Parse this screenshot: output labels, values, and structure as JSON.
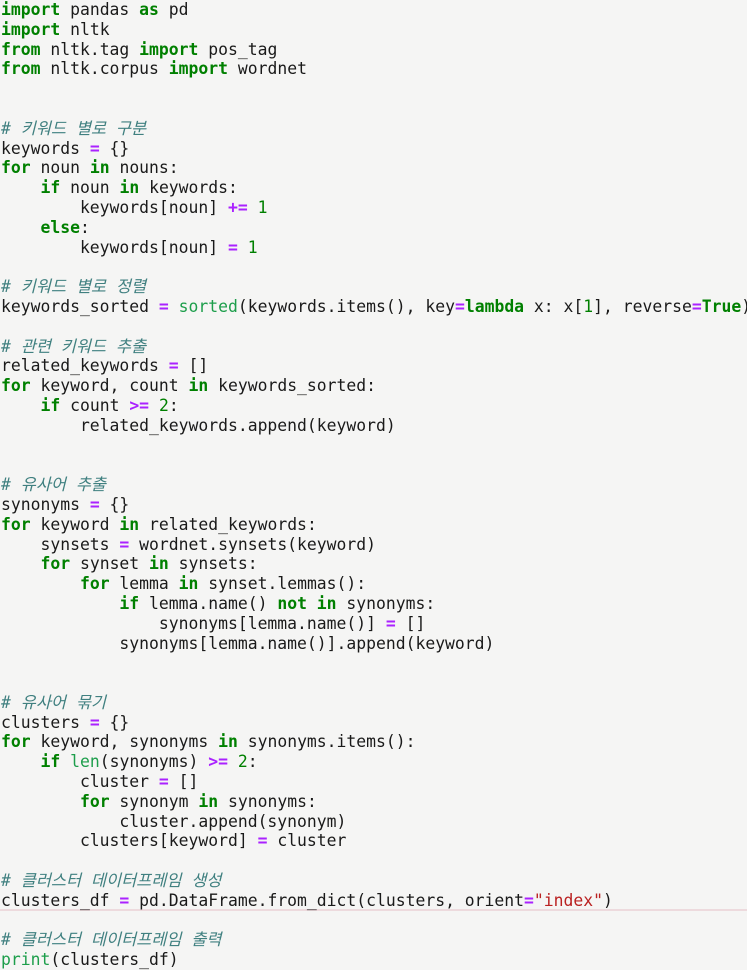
{
  "document": {
    "type": "python-source-code",
    "language": "Python",
    "background_color": "#f5f5f4",
    "bottom_rule_color": "#eddadd",
    "syntax_colors": {
      "keyword": "#008000",
      "builtin": "#1d9e4b",
      "comment": "#408080",
      "operator": "#aa22ff",
      "number": "#008000",
      "string": "#ba2121",
      "plain_text": "#1a1a1a"
    }
  },
  "code": {
    "lines": [
      {
        "id": 1,
        "tokens": [
          {
            "t": "k",
            "v": "import"
          },
          {
            "t": "n",
            "v": " pandas "
          },
          {
            "t": "k",
            "v": "as"
          },
          {
            "t": "n",
            "v": " pd"
          }
        ]
      },
      {
        "id": 2,
        "tokens": [
          {
            "t": "k",
            "v": "import"
          },
          {
            "t": "n",
            "v": " nltk"
          }
        ]
      },
      {
        "id": 3,
        "tokens": [
          {
            "t": "k",
            "v": "from"
          },
          {
            "t": "n",
            "v": " nltk.tag "
          },
          {
            "t": "k",
            "v": "import"
          },
          {
            "t": "n",
            "v": " pos_tag"
          }
        ]
      },
      {
        "id": 4,
        "tokens": [
          {
            "t": "k",
            "v": "from"
          },
          {
            "t": "n",
            "v": " nltk.corpus "
          },
          {
            "t": "k",
            "v": "import"
          },
          {
            "t": "n",
            "v": " wordnet"
          }
        ]
      },
      {
        "id": 5,
        "tokens": []
      },
      {
        "id": 6,
        "tokens": []
      },
      {
        "id": 7,
        "tokens": [
          {
            "t": "c",
            "v": "# 키워드 별로 구분"
          }
        ]
      },
      {
        "id": 8,
        "tokens": [
          {
            "t": "n",
            "v": "keywords "
          },
          {
            "t": "o",
            "v": "="
          },
          {
            "t": "p",
            "v": " {}"
          }
        ]
      },
      {
        "id": 9,
        "tokens": [
          {
            "t": "k",
            "v": "for"
          },
          {
            "t": "n",
            "v": " noun "
          },
          {
            "t": "k",
            "v": "in"
          },
          {
            "t": "n",
            "v": " nouns"
          },
          {
            "t": "p",
            "v": ":"
          }
        ]
      },
      {
        "id": 10,
        "tokens": [
          {
            "t": "n",
            "v": "    "
          },
          {
            "t": "k",
            "v": "if"
          },
          {
            "t": "n",
            "v": " noun "
          },
          {
            "t": "k",
            "v": "in"
          },
          {
            "t": "n",
            "v": " keywords"
          },
          {
            "t": "p",
            "v": ":"
          }
        ]
      },
      {
        "id": 11,
        "tokens": [
          {
            "t": "n",
            "v": "        keywords[noun] "
          },
          {
            "t": "o",
            "v": "+="
          },
          {
            "t": "n",
            "v": " "
          },
          {
            "t": "m",
            "v": "1"
          }
        ]
      },
      {
        "id": 12,
        "tokens": [
          {
            "t": "n",
            "v": "    "
          },
          {
            "t": "k",
            "v": "else"
          },
          {
            "t": "p",
            "v": ":"
          }
        ]
      },
      {
        "id": 13,
        "tokens": [
          {
            "t": "n",
            "v": "        keywords[noun] "
          },
          {
            "t": "o",
            "v": "="
          },
          {
            "t": "n",
            "v": " "
          },
          {
            "t": "m",
            "v": "1"
          }
        ]
      },
      {
        "id": 14,
        "tokens": []
      },
      {
        "id": 15,
        "tokens": [
          {
            "t": "c",
            "v": "# 키워드 별로 정렬"
          }
        ]
      },
      {
        "id": 16,
        "tokens": [
          {
            "t": "n",
            "v": "keywords_sorted "
          },
          {
            "t": "o",
            "v": "="
          },
          {
            "t": "n",
            "v": " "
          },
          {
            "t": "nb",
            "v": "sorted"
          },
          {
            "t": "p",
            "v": "("
          },
          {
            "t": "n",
            "v": "keywords.items(), key"
          },
          {
            "t": "o",
            "v": "="
          },
          {
            "t": "k",
            "v": "lambda"
          },
          {
            "t": "n",
            "v": " x: x["
          },
          {
            "t": "m",
            "v": "1"
          },
          {
            "t": "n",
            "v": "], reverse"
          },
          {
            "t": "o",
            "v": "="
          },
          {
            "t": "kc",
            "v": "True"
          },
          {
            "t": "p",
            "v": ")"
          }
        ]
      },
      {
        "id": 17,
        "tokens": []
      },
      {
        "id": 18,
        "tokens": [
          {
            "t": "c",
            "v": "# 관련 키워드 추출"
          }
        ]
      },
      {
        "id": 19,
        "tokens": [
          {
            "t": "n",
            "v": "related_keywords "
          },
          {
            "t": "o",
            "v": "="
          },
          {
            "t": "p",
            "v": " []"
          }
        ]
      },
      {
        "id": 20,
        "tokens": [
          {
            "t": "k",
            "v": "for"
          },
          {
            "t": "n",
            "v": " keyword, count "
          },
          {
            "t": "k",
            "v": "in"
          },
          {
            "t": "n",
            "v": " keywords_sorted"
          },
          {
            "t": "p",
            "v": ":"
          }
        ]
      },
      {
        "id": 21,
        "tokens": [
          {
            "t": "n",
            "v": "    "
          },
          {
            "t": "k",
            "v": "if"
          },
          {
            "t": "n",
            "v": " count "
          },
          {
            "t": "o",
            "v": ">="
          },
          {
            "t": "n",
            "v": " "
          },
          {
            "t": "m",
            "v": "2"
          },
          {
            "t": "p",
            "v": ":"
          }
        ]
      },
      {
        "id": 22,
        "tokens": [
          {
            "t": "n",
            "v": "        related_keywords.append(keyword)"
          }
        ]
      },
      {
        "id": 23,
        "tokens": []
      },
      {
        "id": 24,
        "tokens": []
      },
      {
        "id": 25,
        "tokens": [
          {
            "t": "c",
            "v": "# 유사어 추출"
          }
        ]
      },
      {
        "id": 26,
        "tokens": [
          {
            "t": "n",
            "v": "synonyms "
          },
          {
            "t": "o",
            "v": "="
          },
          {
            "t": "p",
            "v": " {}"
          }
        ]
      },
      {
        "id": 27,
        "tokens": [
          {
            "t": "k",
            "v": "for"
          },
          {
            "t": "n",
            "v": " keyword "
          },
          {
            "t": "k",
            "v": "in"
          },
          {
            "t": "n",
            "v": " related_keywords"
          },
          {
            "t": "p",
            "v": ":"
          }
        ]
      },
      {
        "id": 28,
        "tokens": [
          {
            "t": "n",
            "v": "    synsets "
          },
          {
            "t": "o",
            "v": "="
          },
          {
            "t": "n",
            "v": " wordnet.synsets(keyword)"
          }
        ]
      },
      {
        "id": 29,
        "tokens": [
          {
            "t": "n",
            "v": "    "
          },
          {
            "t": "k",
            "v": "for"
          },
          {
            "t": "n",
            "v": " synset "
          },
          {
            "t": "k",
            "v": "in"
          },
          {
            "t": "n",
            "v": " synsets"
          },
          {
            "t": "p",
            "v": ":"
          }
        ]
      },
      {
        "id": 30,
        "tokens": [
          {
            "t": "n",
            "v": "        "
          },
          {
            "t": "k",
            "v": "for"
          },
          {
            "t": "n",
            "v": " lemma "
          },
          {
            "t": "k",
            "v": "in"
          },
          {
            "t": "n",
            "v": " synset.lemmas()"
          },
          {
            "t": "p",
            "v": ":"
          }
        ]
      },
      {
        "id": 31,
        "tokens": [
          {
            "t": "n",
            "v": "            "
          },
          {
            "t": "k",
            "v": "if"
          },
          {
            "t": "n",
            "v": " lemma.name() "
          },
          {
            "t": "k",
            "v": "not in"
          },
          {
            "t": "n",
            "v": " synonyms"
          },
          {
            "t": "p",
            "v": ":"
          }
        ]
      },
      {
        "id": 32,
        "tokens": [
          {
            "t": "n",
            "v": "                synonyms[lemma.name()] "
          },
          {
            "t": "o",
            "v": "="
          },
          {
            "t": "p",
            "v": " []"
          }
        ]
      },
      {
        "id": 33,
        "tokens": [
          {
            "t": "n",
            "v": "            synonyms[lemma.name()].append(keyword)"
          }
        ]
      },
      {
        "id": 34,
        "tokens": []
      },
      {
        "id": 35,
        "tokens": []
      },
      {
        "id": 36,
        "tokens": [
          {
            "t": "c",
            "v": "# 유사어 묶기"
          }
        ]
      },
      {
        "id": 37,
        "tokens": [
          {
            "t": "n",
            "v": "clusters "
          },
          {
            "t": "o",
            "v": "="
          },
          {
            "t": "p",
            "v": " {}"
          }
        ]
      },
      {
        "id": 38,
        "tokens": [
          {
            "t": "k",
            "v": "for"
          },
          {
            "t": "n",
            "v": " keyword, synonyms "
          },
          {
            "t": "k",
            "v": "in"
          },
          {
            "t": "n",
            "v": " synonyms.items()"
          },
          {
            "t": "p",
            "v": ":"
          }
        ]
      },
      {
        "id": 39,
        "tokens": [
          {
            "t": "n",
            "v": "    "
          },
          {
            "t": "k",
            "v": "if"
          },
          {
            "t": "n",
            "v": " "
          },
          {
            "t": "nb",
            "v": "len"
          },
          {
            "t": "n",
            "v": "(synonyms) "
          },
          {
            "t": "o",
            "v": ">="
          },
          {
            "t": "n",
            "v": " "
          },
          {
            "t": "m",
            "v": "2"
          },
          {
            "t": "p",
            "v": ":"
          }
        ]
      },
      {
        "id": 40,
        "tokens": [
          {
            "t": "n",
            "v": "        cluster "
          },
          {
            "t": "o",
            "v": "="
          },
          {
            "t": "p",
            "v": " []"
          }
        ]
      },
      {
        "id": 41,
        "tokens": [
          {
            "t": "n",
            "v": "        "
          },
          {
            "t": "k",
            "v": "for"
          },
          {
            "t": "n",
            "v": " synonym "
          },
          {
            "t": "k",
            "v": "in"
          },
          {
            "t": "n",
            "v": " synonyms"
          },
          {
            "t": "p",
            "v": ":"
          }
        ]
      },
      {
        "id": 42,
        "tokens": [
          {
            "t": "n",
            "v": "            cluster.append(synonym)"
          }
        ]
      },
      {
        "id": 43,
        "tokens": [
          {
            "t": "n",
            "v": "        clusters[keyword] "
          },
          {
            "t": "o",
            "v": "="
          },
          {
            "t": "n",
            "v": " cluster"
          }
        ]
      },
      {
        "id": 44,
        "tokens": []
      },
      {
        "id": 45,
        "tokens": [
          {
            "t": "c",
            "v": "# 클러스터 데이터프레임 생성"
          }
        ]
      },
      {
        "id": 46,
        "tokens": [
          {
            "t": "n",
            "v": "clusters_df "
          },
          {
            "t": "o",
            "v": "="
          },
          {
            "t": "n",
            "v": " pd.DataFrame.from_dict(clusters, orient"
          },
          {
            "t": "o",
            "v": "="
          },
          {
            "t": "s",
            "v": "\"index\""
          },
          {
            "t": "p",
            "v": ")"
          }
        ]
      },
      {
        "id": 47,
        "tokens": []
      },
      {
        "id": 48,
        "tokens": [
          {
            "t": "c",
            "v": "# 클러스터 데이터프레임 출력"
          }
        ]
      },
      {
        "id": 49,
        "tokens": [
          {
            "t": "nb",
            "v": "print"
          },
          {
            "t": "p",
            "v": "("
          },
          {
            "t": "n",
            "v": "clusters_df"
          },
          {
            "t": "p",
            "v": ")"
          }
        ]
      }
    ]
  }
}
